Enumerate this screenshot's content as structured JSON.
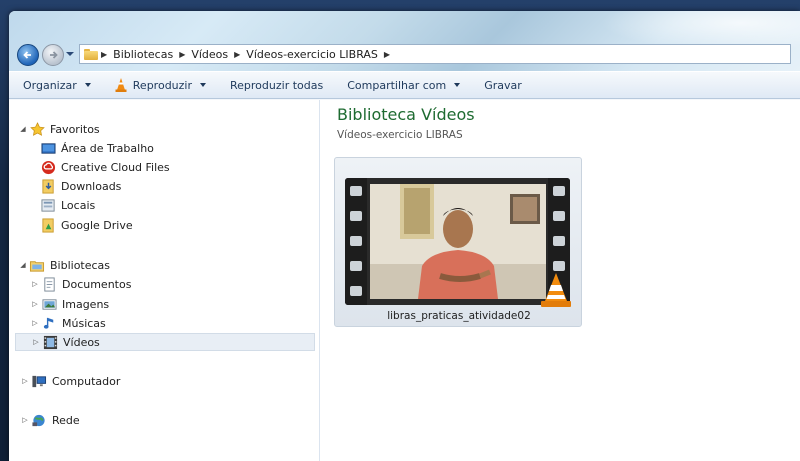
{
  "window": {
    "breadcrumb": [
      "Bibliotecas",
      "Vídeos",
      "Vídeos-exercicio LIBRAS"
    ]
  },
  "toolbar": {
    "organize": "Organizar",
    "play": "Reproduzir",
    "play_all": "Reproduzir todas",
    "share": "Compartilhar com",
    "burn": "Gravar"
  },
  "nav": {
    "favorites": {
      "label": "Favoritos",
      "items": [
        "Área de Trabalho",
        "Creative Cloud Files",
        "Downloads",
        "Locais",
        "Google Drive"
      ]
    },
    "libraries": {
      "label": "Bibliotecas",
      "items": [
        "Documentos",
        "Imagens",
        "Músicas",
        "Vídeos"
      ],
      "selected": "Vídeos"
    },
    "computer": "Computador",
    "network": "Rede"
  },
  "content": {
    "title": "Biblioteca Vídeos",
    "subtitle": "Vídeos-exercicio LIBRAS",
    "files": [
      {
        "name": "libras_praticas_atividade02",
        "icon": "vlc-cone-icon"
      }
    ]
  },
  "colors": {
    "title_green": "#1e6b31",
    "toolbar_text": "#1e395b",
    "selection_bg": "#e8eef5"
  }
}
